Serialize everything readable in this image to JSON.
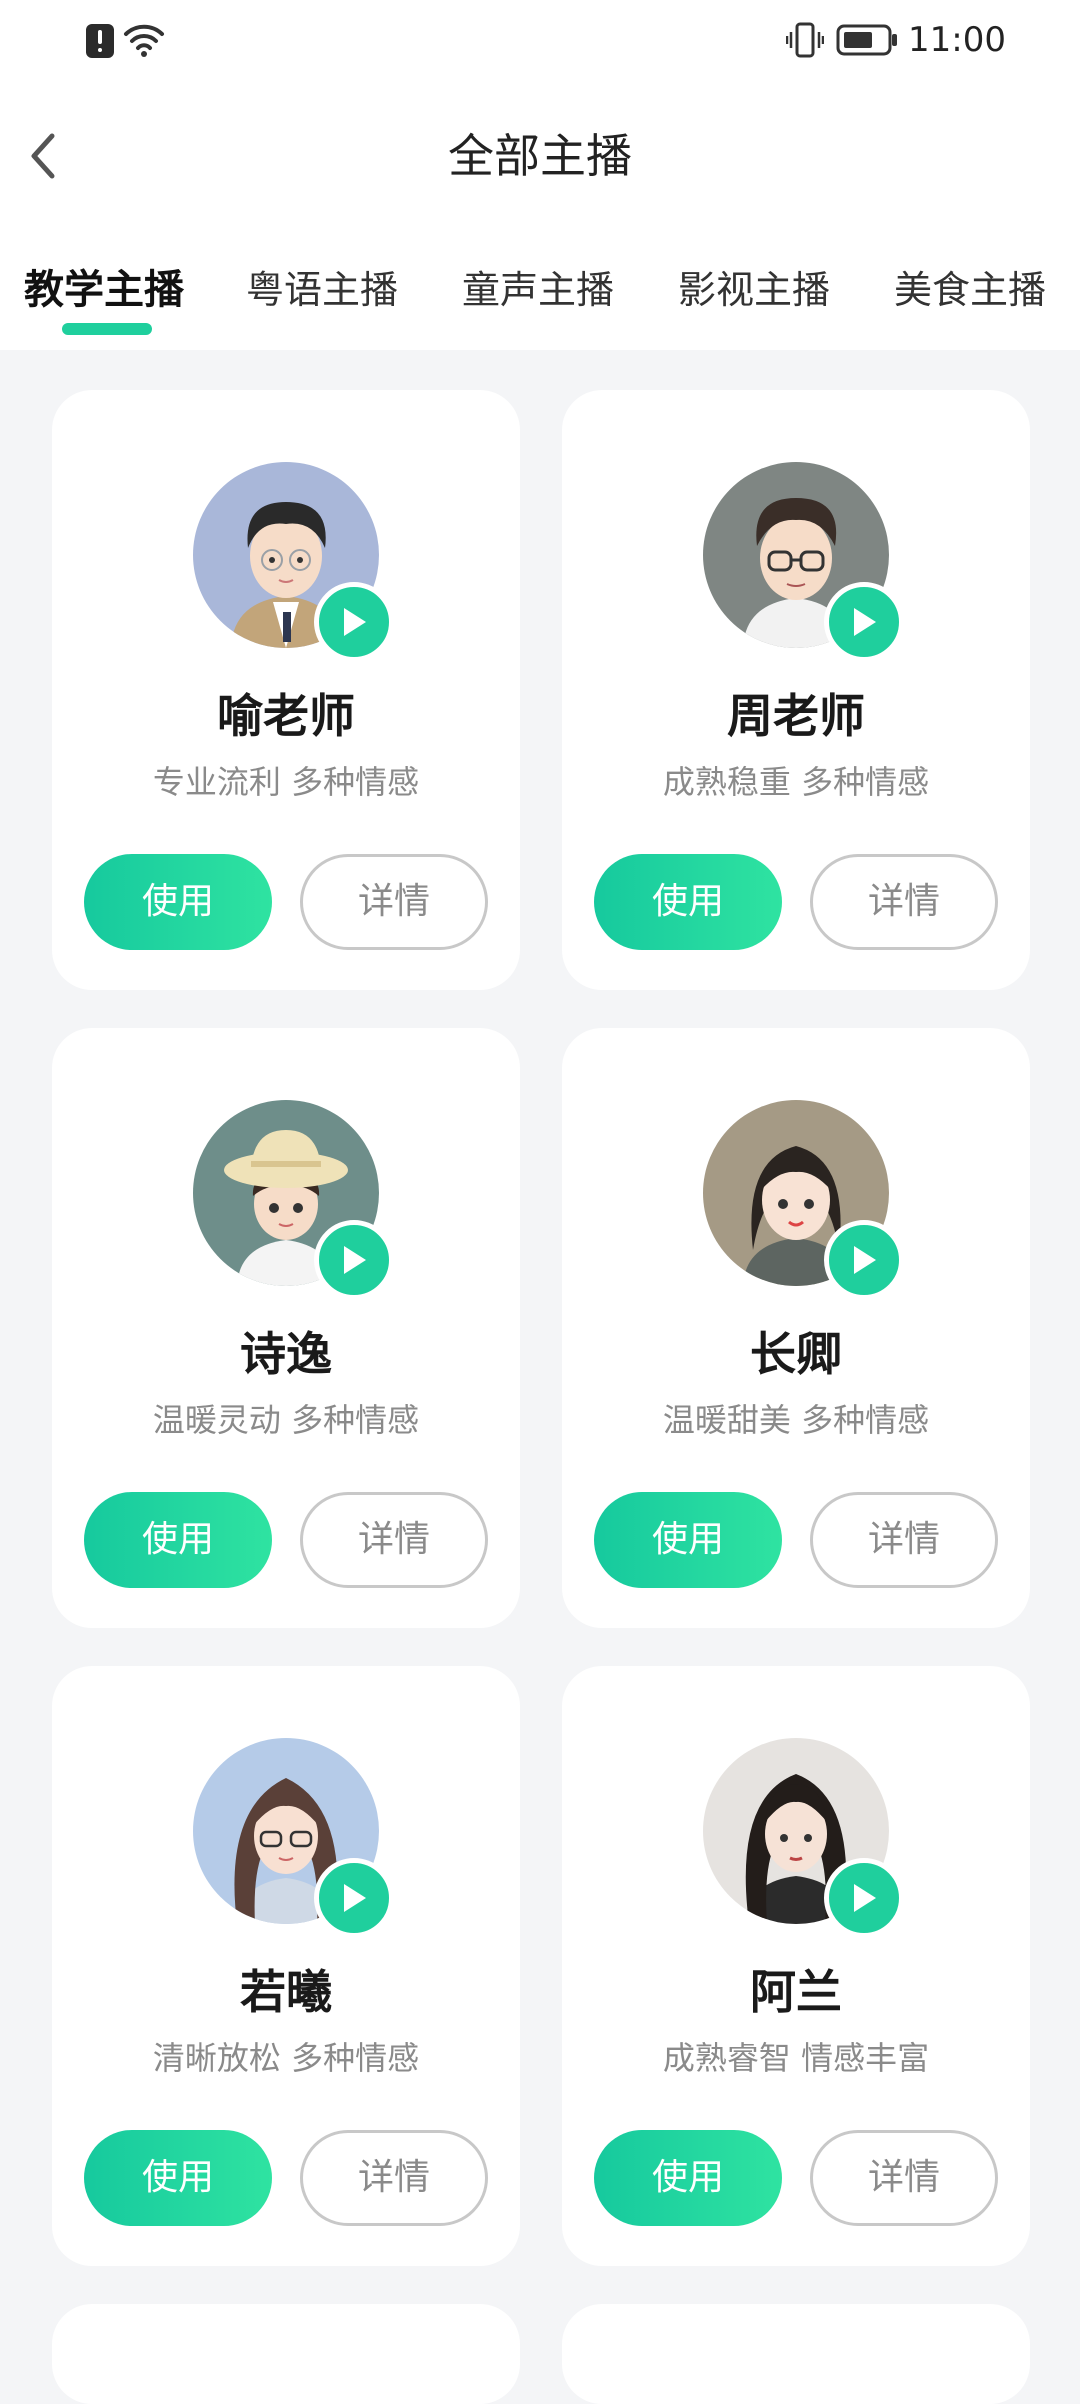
{
  "status_bar": {
    "time": "11:00",
    "icons": [
      "alert-icon",
      "wifi-icon",
      "vibrate-icon",
      "battery-icon"
    ]
  },
  "header": {
    "title": "全部主播",
    "back_icon": "chevron-left-icon"
  },
  "tabs": [
    {
      "label": "教学主播",
      "active": true
    },
    {
      "label": "粤语主播",
      "active": false
    },
    {
      "label": "童声主播",
      "active": false
    },
    {
      "label": "影视主播",
      "active": false
    },
    {
      "label": "美食主播",
      "active": false
    }
  ],
  "colors": {
    "accent": "#1fcf9d",
    "page_bg": "#f4f5f7",
    "muted_text": "#8a8a8a"
  },
  "cards": [
    {
      "name": "喻老师",
      "desc": "专业流利 多种情感",
      "use_label": "使用",
      "detail_label": "详情"
    },
    {
      "name": "周老师",
      "desc": "成熟稳重 多种情感",
      "use_label": "使用",
      "detail_label": "详情"
    },
    {
      "name": "诗逸",
      "desc": "温暖灵动  多种情感",
      "use_label": "使用",
      "detail_label": "详情"
    },
    {
      "name": "长卿",
      "desc": "温暖甜美 多种情感",
      "use_label": "使用",
      "detail_label": "详情"
    },
    {
      "name": "若曦",
      "desc": "清晰放松 多种情感",
      "use_label": "使用",
      "detail_label": "详情"
    },
    {
      "name": "阿兰",
      "desc": "成熟睿智 情感丰富",
      "use_label": "使用",
      "detail_label": "详情"
    }
  ]
}
